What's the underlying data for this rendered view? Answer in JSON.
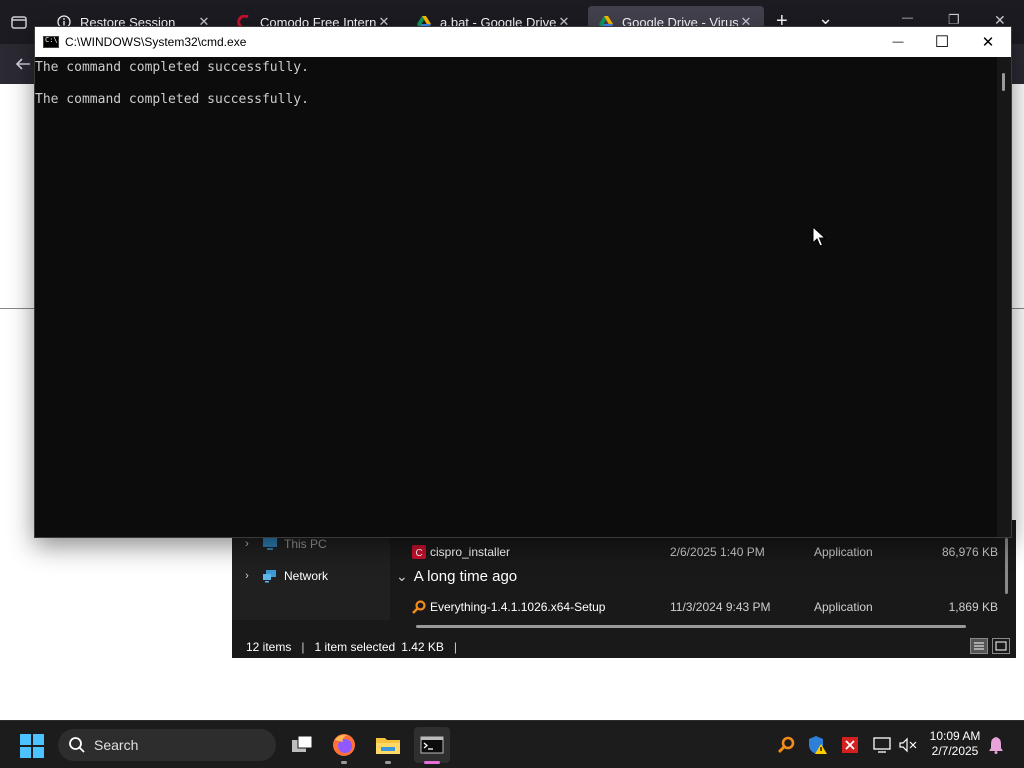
{
  "browser": {
    "tabs": [
      {
        "label": "Restore Session",
        "close": "✕"
      },
      {
        "label": "Comodo Free Internet",
        "close": "✕"
      },
      {
        "label": "a.bat - Google Drive",
        "close": "✕"
      },
      {
        "label": "Google Drive - Virus sc",
        "close": "✕"
      }
    ],
    "new_tab": "+",
    "tab_list": "⌄",
    "window_controls": {
      "minimize": "—",
      "restore": "❐",
      "close": "✕"
    }
  },
  "cmd": {
    "title": "C:\\WINDOWS\\System32\\cmd.exe",
    "lines": [
      "The command completed successfully.",
      "",
      "The command completed successfully."
    ],
    "controls": {
      "minimize": "—",
      "maximize": "☐",
      "close": "✕"
    }
  },
  "explorer": {
    "nav": [
      {
        "label": "This PC",
        "chevron": "›"
      },
      {
        "label": "Network",
        "chevron": "›"
      }
    ],
    "group_header": "A long time ago",
    "group_chevron": "⌄",
    "files": [
      {
        "name": "cispro_installer",
        "date": "2/6/2025 1:40 PM",
        "type": "Application",
        "size": "86,976 KB",
        "icon": "comodo-installer-icon"
      },
      {
        "name": "Everything-1.4.1.1026.x64-Setup",
        "date": "11/3/2024 9:43 PM",
        "type": "Application",
        "size": "1,869 KB",
        "icon": "everything-search-icon"
      }
    ],
    "status": {
      "items": "12 items",
      "selected": "1 item selected",
      "size": "1.42 KB",
      "sep": "|"
    }
  },
  "taskbar": {
    "search_placeholder": "Search",
    "time": "10:09 AM",
    "date": "2/7/2025"
  },
  "colors": {
    "cmd_bg": "#0c0c0c",
    "cmd_text": "#cccccc",
    "taskbar_bg": "#1c1c1c",
    "accent_blue": "#4cc2ff"
  }
}
